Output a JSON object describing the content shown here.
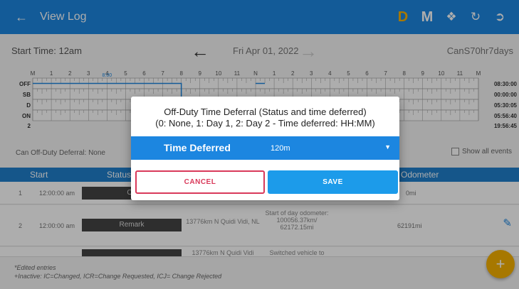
{
  "appbar": {
    "title": "View Log",
    "back_icon": "arrow-left-icon",
    "d_label": "D",
    "m_label": "M",
    "colors": {
      "bar": "#1c86e0",
      "d": "#f6b200"
    }
  },
  "datebar": {
    "start_time": "Start Time: 12am",
    "date": "Fri Apr 01, 2022",
    "cycle": "CanS70hr7days"
  },
  "graph": {
    "hour_labels": [
      "M",
      "1",
      "2",
      "3",
      "4",
      "5",
      "6",
      "7",
      "8",
      "9",
      "10",
      "11",
      "N",
      "1",
      "2",
      "3",
      "4",
      "5",
      "6",
      "7",
      "8",
      "9",
      "10",
      "11",
      "M"
    ],
    "row_labels": [
      "OFF",
      "SB",
      "D",
      "ON"
    ],
    "totals": [
      "08:30:00",
      "00:00:00",
      "05:30:05",
      "05:56:40"
    ],
    "total_all": "19:56:45",
    "marker_label": "8:00",
    "count_label": "2"
  },
  "deferral_text": "Can Off-Duty Deferral: None",
  "show_all_events": "Show all events",
  "table": {
    "headers": {
      "start": "Start",
      "status": "Status",
      "odometer": "Odometer"
    },
    "rows": [
      {
        "num": "1",
        "time": "12:00:00 am",
        "status": "Off",
        "location": "",
        "note": "",
        "odometer": "0mi"
      },
      {
        "num": "2",
        "time": "12:00:00 am",
        "status": "Remark",
        "location": "13776km N Quidi Vidi, NL",
        "note": "Start of day odometer: 100056.37km/ 62172.15mi",
        "odometer": "62191mi"
      },
      {
        "num": "",
        "time": "",
        "status": "",
        "location": "13776km N Quidi Vidi",
        "note": "Switched vehicle to",
        "odometer": ""
      }
    ]
  },
  "footer": {
    "line1": "*Edited entries",
    "line2": "+Inactive: IC=Changed, ICR=Change Requested, ICJ= Change Rejected"
  },
  "dialog": {
    "title_line1": "Off-Duty Time Deferral (Status and time deferred)",
    "title_line2": "(0: None, 1: Day 1, 2: Day 2 - Time deferred: HH:MM)",
    "select_label": "Time Deferred",
    "select_value": "120m",
    "cancel_label": "CANCEL",
    "save_label": "SAVE"
  }
}
